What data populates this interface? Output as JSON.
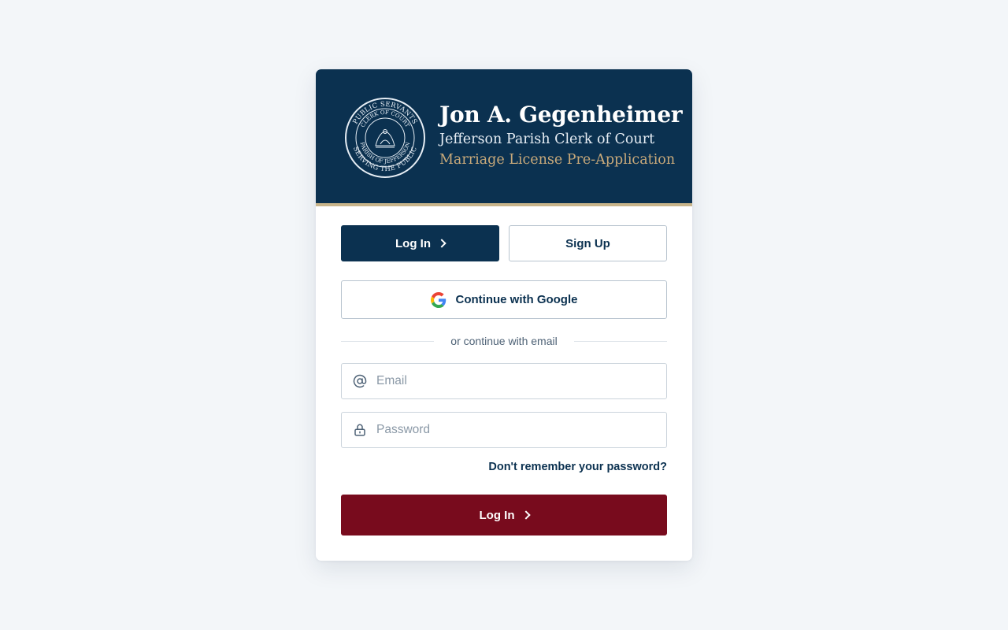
{
  "header": {
    "official_name": "Jon A. Gegenheimer",
    "office": "Jefferson Parish Clerk of Court",
    "application": "Marriage License Pre-Application",
    "seal": {
      "outer_text": "PUBLIC SERVANTS · SERVING THE PUBLIC",
      "inner_text": "CLERK OF COURT · PARISH OF JEFFERSON",
      "icon": "pelican-seal-icon"
    }
  },
  "tabs": {
    "login_label": "Log In",
    "signup_label": "Sign Up"
  },
  "google": {
    "label": "Continue with Google",
    "icon": "google-g-icon"
  },
  "divider": {
    "text": "or continue with email"
  },
  "form": {
    "email": {
      "value": "",
      "placeholder": "Email",
      "icon": "at-sign-icon"
    },
    "password": {
      "value": "",
      "placeholder": "Password",
      "icon": "lock-icon"
    },
    "forgot_label": "Don't remember your password?",
    "submit_label": "Log In"
  },
  "colors": {
    "navy": "#0b3150",
    "gold": "#c8a97a",
    "maroon": "#780b1d",
    "background": "#f3f6f9"
  }
}
